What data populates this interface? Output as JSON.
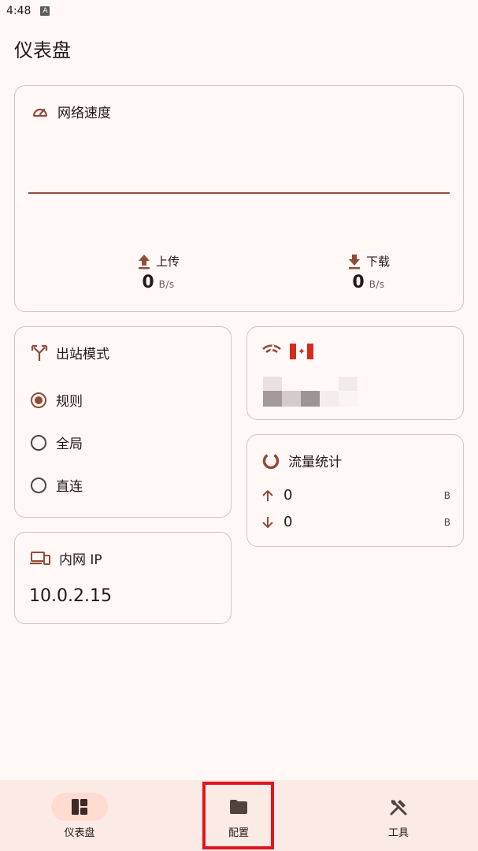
{
  "status_bar": {
    "time": "4:48",
    "badge": "A"
  },
  "page": {
    "title": "仪表盘"
  },
  "network_speed": {
    "title": "网络速度",
    "upload": {
      "label": "上传",
      "value": "0",
      "unit": "B/s"
    },
    "download": {
      "label": "下载",
      "value": "0",
      "unit": "B/s"
    }
  },
  "outbound_mode": {
    "title": "出站模式",
    "options": [
      {
        "label": "规则",
        "selected": true
      },
      {
        "label": "全局",
        "selected": false
      },
      {
        "label": "直连",
        "selected": false
      }
    ]
  },
  "intranet_ip": {
    "title": "内网 IP",
    "value": "10.0.2.15"
  },
  "network_detection": {
    "flag": "canada-flag"
  },
  "traffic_stats": {
    "title": "流量统计",
    "upload": {
      "value": "0",
      "unit": "B"
    },
    "download": {
      "value": "0",
      "unit": "B"
    }
  },
  "bottom_nav": {
    "items": [
      {
        "label": "仪表盘",
        "icon": "dashboard-icon",
        "active": true
      },
      {
        "label": "配置",
        "icon": "folder-icon",
        "active": false
      },
      {
        "label": "工具",
        "icon": "tools-icon",
        "active": false
      }
    ]
  },
  "colors": {
    "accent": "#8f4c38",
    "background": "#fff8f6",
    "nav_background": "#fceae5",
    "active_pill": "#ffdbd0",
    "highlight": "#e0161e"
  }
}
